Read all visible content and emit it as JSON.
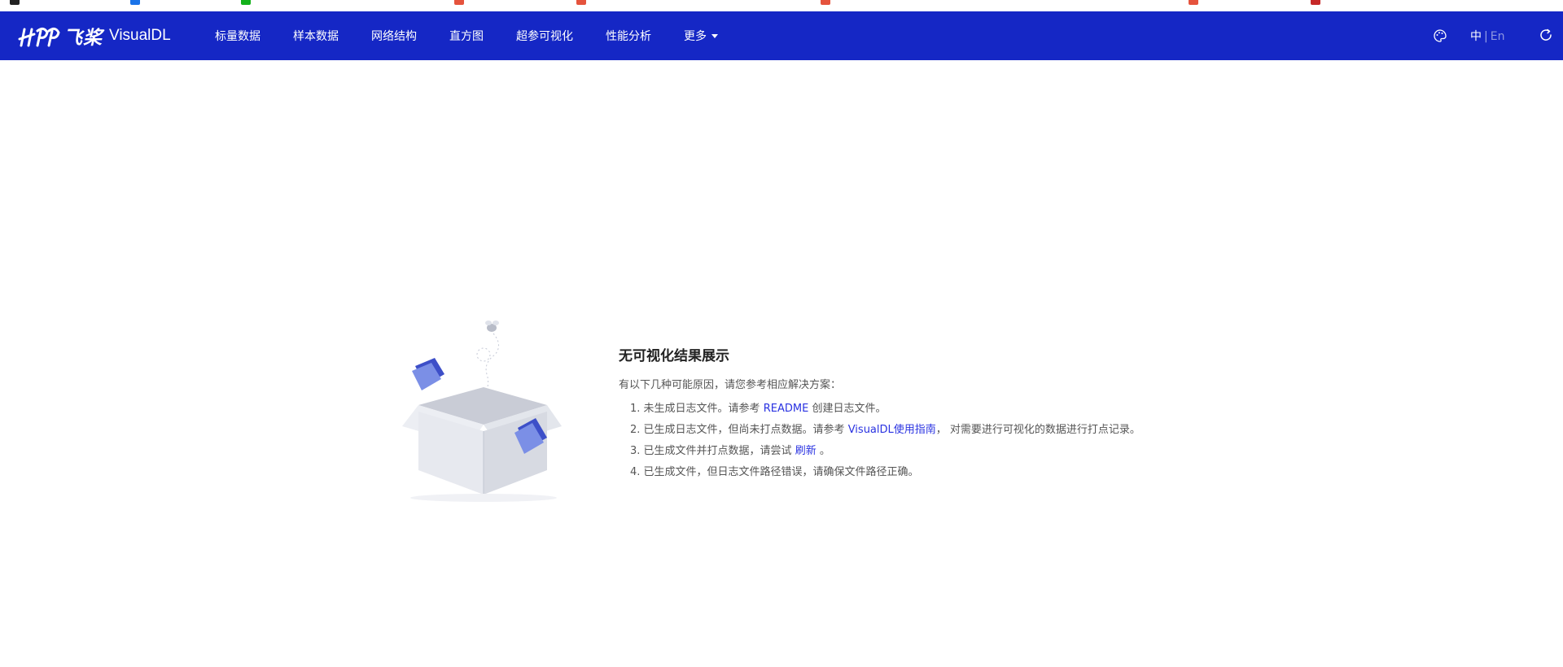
{
  "navbar": {
    "logo_brand": "飞桨",
    "logo_product": "VisualDL",
    "items": [
      {
        "label": "标量数据"
      },
      {
        "label": "样本数据"
      },
      {
        "label": "网络结构"
      },
      {
        "label": "直方图"
      },
      {
        "label": "超参可视化"
      },
      {
        "label": "性能分析"
      },
      {
        "label": "更多"
      }
    ],
    "lang_zh": "中",
    "lang_separator": "|",
    "lang_en": "En",
    "icons": {
      "theme": "palette-icon",
      "refresh": "refresh-icon",
      "more_dropdown": "caret-down-icon"
    }
  },
  "empty_state": {
    "title": "无可视化结果展示",
    "intro": "有以下几种可能原因，请您参考相应解决方案：",
    "reasons": [
      {
        "num": "1.",
        "before": "未生成日志文件。请参考",
        "link": "README",
        "after": "创建日志文件。"
      },
      {
        "num": "2.",
        "before": "已生成日志文件，但尚未打点数据。请参考",
        "link": "VisualDL使用指南",
        "after": "， 对需要进行可视化的数据进行打点记录。"
      },
      {
        "num": "3.",
        "before": "已生成文件并打点数据，请尝试",
        "link": "刷新",
        "after": "。"
      },
      {
        "num": "4.",
        "before": "已生成文件，但日志文件路径错误，请确保文件路径正确。",
        "link": "",
        "after": ""
      }
    ]
  },
  "colors": {
    "navbar_bg": "#1527c5",
    "link": "#2932e1",
    "page_bg": "#ffffff"
  }
}
